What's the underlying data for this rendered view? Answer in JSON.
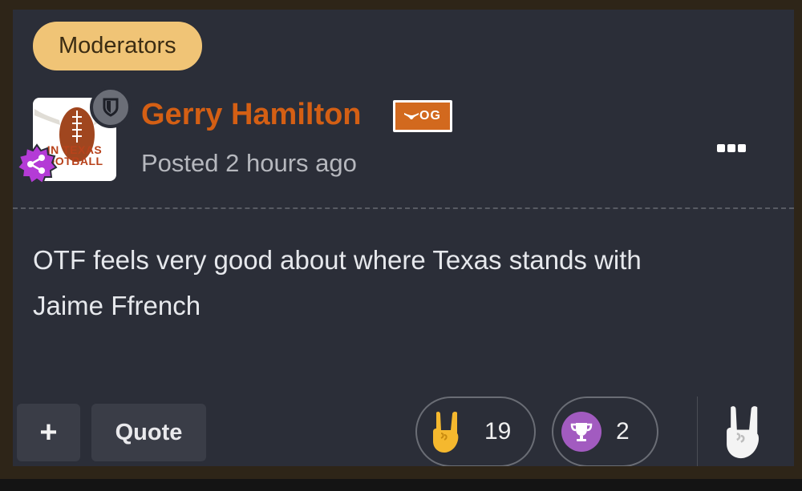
{
  "post": {
    "group_badge": "Moderators",
    "author": {
      "name": "Gerry Hamilton",
      "avatar_text_line1": "IN TEXAS",
      "avatar_text_line2": "OOTBALL",
      "rank_badge": "OG"
    },
    "posted_time": "Posted 2 hours ago",
    "body_line1": "OTF feels very good about where Texas stands with",
    "body_line2": "Jaime Ffrench",
    "actions": {
      "plus_label": "+",
      "quote_label": "Quote"
    },
    "reactions": [
      {
        "icon": "horns-icon",
        "count": "19"
      },
      {
        "icon": "trophy-icon",
        "count": "2"
      }
    ]
  },
  "colors": {
    "card_bg": "#2b2e38",
    "badge_bg": "#f0c476",
    "author_name": "#d45f14",
    "trophy_purple": "#a25bc0",
    "share_purple": "#b43bd6"
  }
}
